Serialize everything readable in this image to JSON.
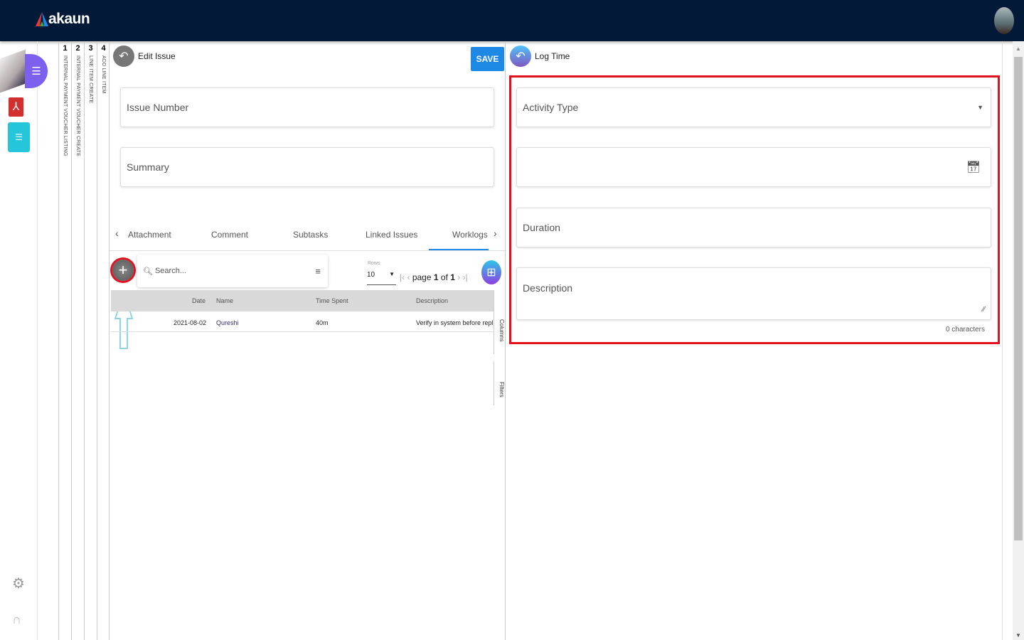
{
  "header": {
    "logo_text": "akaun"
  },
  "vertical_tabs": [
    {
      "num": "1",
      "label": "INTERNAL PAYMENT VOUCHER LISTING"
    },
    {
      "num": "2",
      "label": "INTERNAL PAYMENT VOUCHER CREATE"
    },
    {
      "num": "3",
      "label": "LINE ITEM CREATE"
    },
    {
      "num": "4",
      "label": "ADD LINE ITEM"
    }
  ],
  "edit_issue": {
    "title": "Edit Issue",
    "save_label": "SAVE",
    "issue_number_placeholder": "Issue Number",
    "summary_placeholder": "Summary",
    "tabs": [
      "Attachment",
      "Comment",
      "Subtasks",
      "Linked Issues",
      "Worklogs"
    ],
    "active_tab": "Worklogs",
    "search_placeholder": "Search...",
    "rows_label": "Rows",
    "rows_value": "10",
    "pagination": {
      "page_label": "page",
      "page": "1",
      "of_label": "of",
      "total": "1"
    },
    "columns": [
      "Date",
      "Name",
      "Time Spent",
      "Description"
    ],
    "rows": [
      {
        "date": "2021-08-02",
        "name": "Qureshi",
        "time_spent": "40m",
        "description": "Verify in system before reply"
      }
    ],
    "side_columns": "Columns",
    "side_filters": "Filters"
  },
  "log_time": {
    "title": "Log Time",
    "activity_type_placeholder": "Activity Type",
    "duration_placeholder": "Duration",
    "description_placeholder": "Description",
    "char_count": "0 characters"
  },
  "colors": {
    "header": "#021a38",
    "accent": "#1e88e5",
    "highlight": "#e3101e",
    "annotation_arrow": "#8fd3e8"
  }
}
